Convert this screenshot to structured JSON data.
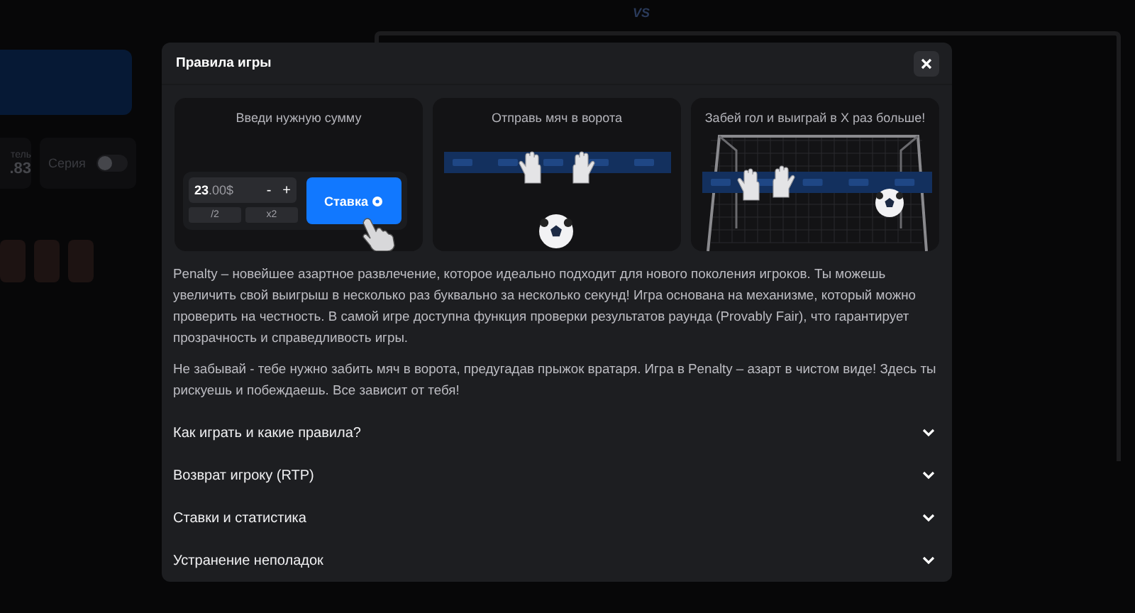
{
  "background": {
    "versus": "VS",
    "stat_label": "тель",
    "stat_value": ".83",
    "streak": {
      "label": "Серия",
      "on": false
    }
  },
  "modal": {
    "title": "Правила игры",
    "steps": [
      {
        "kind": "bet",
        "caption": "Введи нужную сумму",
        "amount": "**23**.00$",
        "minus": "-",
        "plus": "+",
        "half": "/2",
        "double": "x2",
        "button": "Ставка"
      },
      {
        "kind": "kick",
        "caption": "Отправь мяч в ворота"
      },
      {
        "kind": "goal",
        "caption": "Забей гол и выиграй в X раз больше!"
      }
    ],
    "paragraphs": [
      "Penalty – новейшее азартное развлечение, которое идеально подходит для нового поколения игроков. Ты можешь увеличить свой выигрыш в несколько раз буквально за несколько секунд! Игра основана на механизме, который можно проверить на честность. В самой игре доступна функция проверки результатов раунда (Provably Fair), что гарантирует прозрачность и справедливость игры.",
      "Не забывай - тебе нужно забить мяч в ворота, предугадав прыжок вратаря. Игра в Penalty – азарт в чистом виде! Здесь ты рискуешь и побеждаешь. Все зависит от тебя!"
    ],
    "sections": [
      {
        "title": "Как играть и какие правила?",
        "expanded": false
      },
      {
        "title": "Возврат игроку (RTP)",
        "expanded": false
      },
      {
        "title": "Ставки и статистика",
        "expanded": false
      },
      {
        "title": "Устранение неполадок",
        "expanded": false
      }
    ]
  }
}
